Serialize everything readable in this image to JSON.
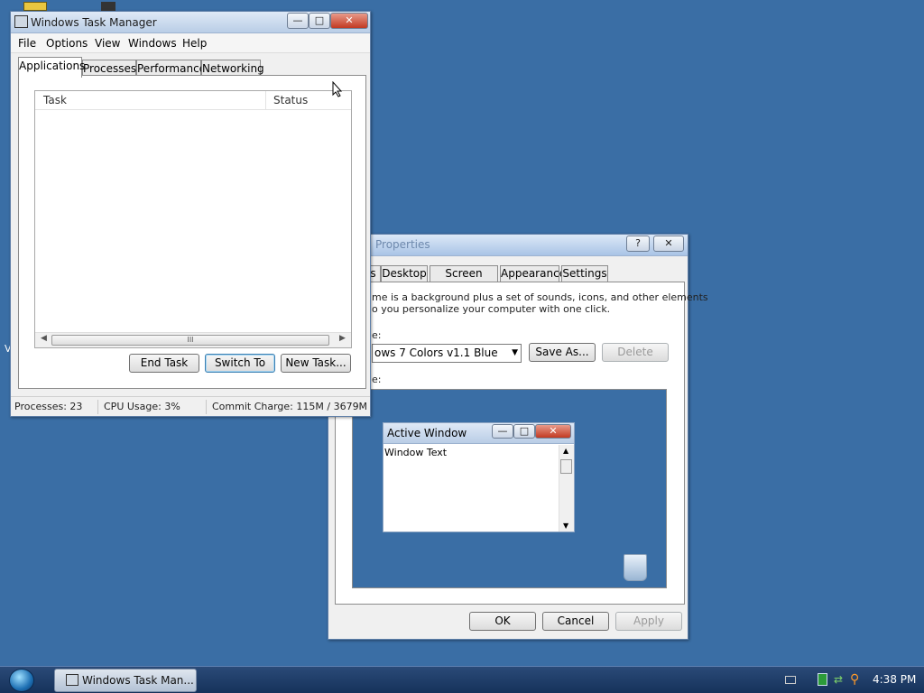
{
  "task_manager": {
    "title": "Windows Task Manager",
    "menu": [
      "File",
      "Options",
      "View",
      "Windows",
      "Help"
    ],
    "tabs": [
      "Applications",
      "Processes",
      "Performance",
      "Networking"
    ],
    "columns": [
      "Task",
      "Status"
    ],
    "buttons": {
      "end_task": "End Task",
      "switch_to": "Switch To",
      "new_task": "New Task..."
    },
    "status": {
      "processes": "Processes: 23",
      "cpu": "CPU Usage: 3%",
      "commit": "Commit Charge: 115M / 3679M"
    },
    "scroll_grip": "III"
  },
  "display_properties": {
    "title": "Properties",
    "tabs": [
      "s",
      "Desktop",
      "Screen Saver",
      "Appearance",
      "Settings"
    ],
    "description_line1": "me is a background plus a set of sounds, icons, and other elements",
    "description_line2": "o you personalize your computer with one click.",
    "theme_label": "e:",
    "theme_value": "ows 7 Colors v1.1 Blue",
    "save_as": "Save As...",
    "delete": "Delete",
    "sample_label": "e:",
    "preview": {
      "active_window": "Active Window",
      "window_text": "Window Text"
    },
    "ok": "OK",
    "cancel": "Cancel",
    "apply": "Apply"
  },
  "taskbar": {
    "task_button": "Windows Task Man...",
    "time": "4:38 PM"
  },
  "desktop": {
    "edge_letter": "V"
  }
}
